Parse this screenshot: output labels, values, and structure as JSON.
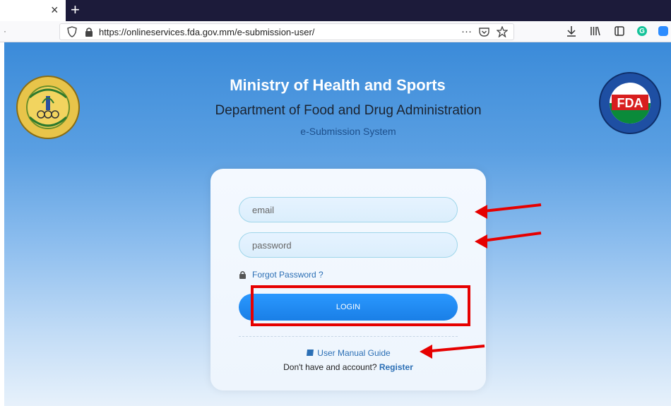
{
  "browser": {
    "tab_close": "×",
    "tab_new": "+",
    "url": "https://onlineservices.fda.gov.mm/e-submission-user/",
    "url_more": "···",
    "icons": [
      "shield-icon",
      "lock-icon",
      "pocket-icon",
      "star-icon",
      "download-icon",
      "library-icon",
      "reader-icon",
      "grammarly-icon",
      "zoom-icon",
      "extension-icon"
    ]
  },
  "header": {
    "title": "Ministry of Health and Sports",
    "subtitle": "Department of Food and Drug Administration",
    "system": "e-Submission System"
  },
  "logos": {
    "left_text": "MINISTRY OF HEALTH AND SPORTS",
    "right_text": "FDA",
    "right_ring_text": "MINISTRY OF HEALTH AND SPORTS"
  },
  "login_form": {
    "email_placeholder": "email",
    "password_placeholder": "password",
    "forgot_label": "Forgot Password ?",
    "login_label": "LOGIN",
    "manual_label": "User Manual Guide",
    "no_account_text": "Don't have and account?",
    "register_label": "Register"
  },
  "colors": {
    "accent": "#1a86ee",
    "annotation": "#e60000",
    "link": "#2b6fb5"
  }
}
